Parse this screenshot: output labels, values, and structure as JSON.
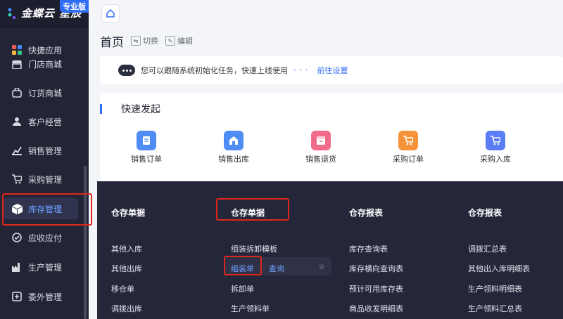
{
  "brand": {
    "name": "金蝶云 星辰",
    "badge": "专业版"
  },
  "sidebar": {
    "items": [
      {
        "label": "快捷应用",
        "icon": "apps-grid-icon"
      },
      {
        "label": "门店商城",
        "icon": "storefront-icon"
      },
      {
        "label": "订货商城",
        "icon": "shopping-bag-icon"
      },
      {
        "label": "客户经营",
        "icon": "customer-icon"
      },
      {
        "label": "销售管理",
        "icon": "sales-chart-icon"
      },
      {
        "label": "采购管理",
        "icon": "cart-icon"
      },
      {
        "label": "库存管理",
        "icon": "box-icon"
      },
      {
        "label": "应收应付",
        "icon": "receivable-icon"
      },
      {
        "label": "生产管理",
        "icon": "factory-icon"
      },
      {
        "label": "委外管理",
        "icon": "outsourcing-icon"
      }
    ]
  },
  "page": {
    "title": "首页",
    "switch_label": "切换",
    "edit_label": "编辑"
  },
  "notice": {
    "text": "您可以跟随系统初始化任务，快速上线使用",
    "dots": "› › ›",
    "link": "前往设置"
  },
  "quick": {
    "title": "快速发起",
    "items": [
      {
        "label": "销售订单",
        "color": "#4f8df5"
      },
      {
        "label": "销售出库",
        "color": "#4f8df5"
      },
      {
        "label": "销售退货",
        "color": "#f06a8a"
      },
      {
        "label": "采购订单",
        "color": "#f5923a"
      },
      {
        "label": "采购入库",
        "color": "#5a7cf5"
      }
    ]
  },
  "panel": {
    "columns": [
      {
        "title": "仓存单据",
        "items": [
          "其他入库",
          "其他出库",
          "移仓单",
          "调拨出库"
        ]
      },
      {
        "title": "仓存单据",
        "items": [
          "组装拆卸模板",
          "组装单",
          "拆卸单",
          "生产领料单"
        ]
      },
      {
        "title": "仓存报表",
        "items": [
          "库存查询表",
          "库存横向查询表",
          "预计可用库存表",
          "商品收发明细表"
        ]
      },
      {
        "title": "仓存报表",
        "items": [
          "调拨汇总表",
          "其他出入库明细表",
          "生产领料明细表",
          "生产领料汇总表"
        ]
      }
    ],
    "query_label": "查询",
    "star": "☆"
  },
  "colors": {
    "accent": "#2f6df6",
    "highlight_box": "#e0261b",
    "sidebar_bg": "#232536",
    "panel_bg": "#24263a"
  }
}
